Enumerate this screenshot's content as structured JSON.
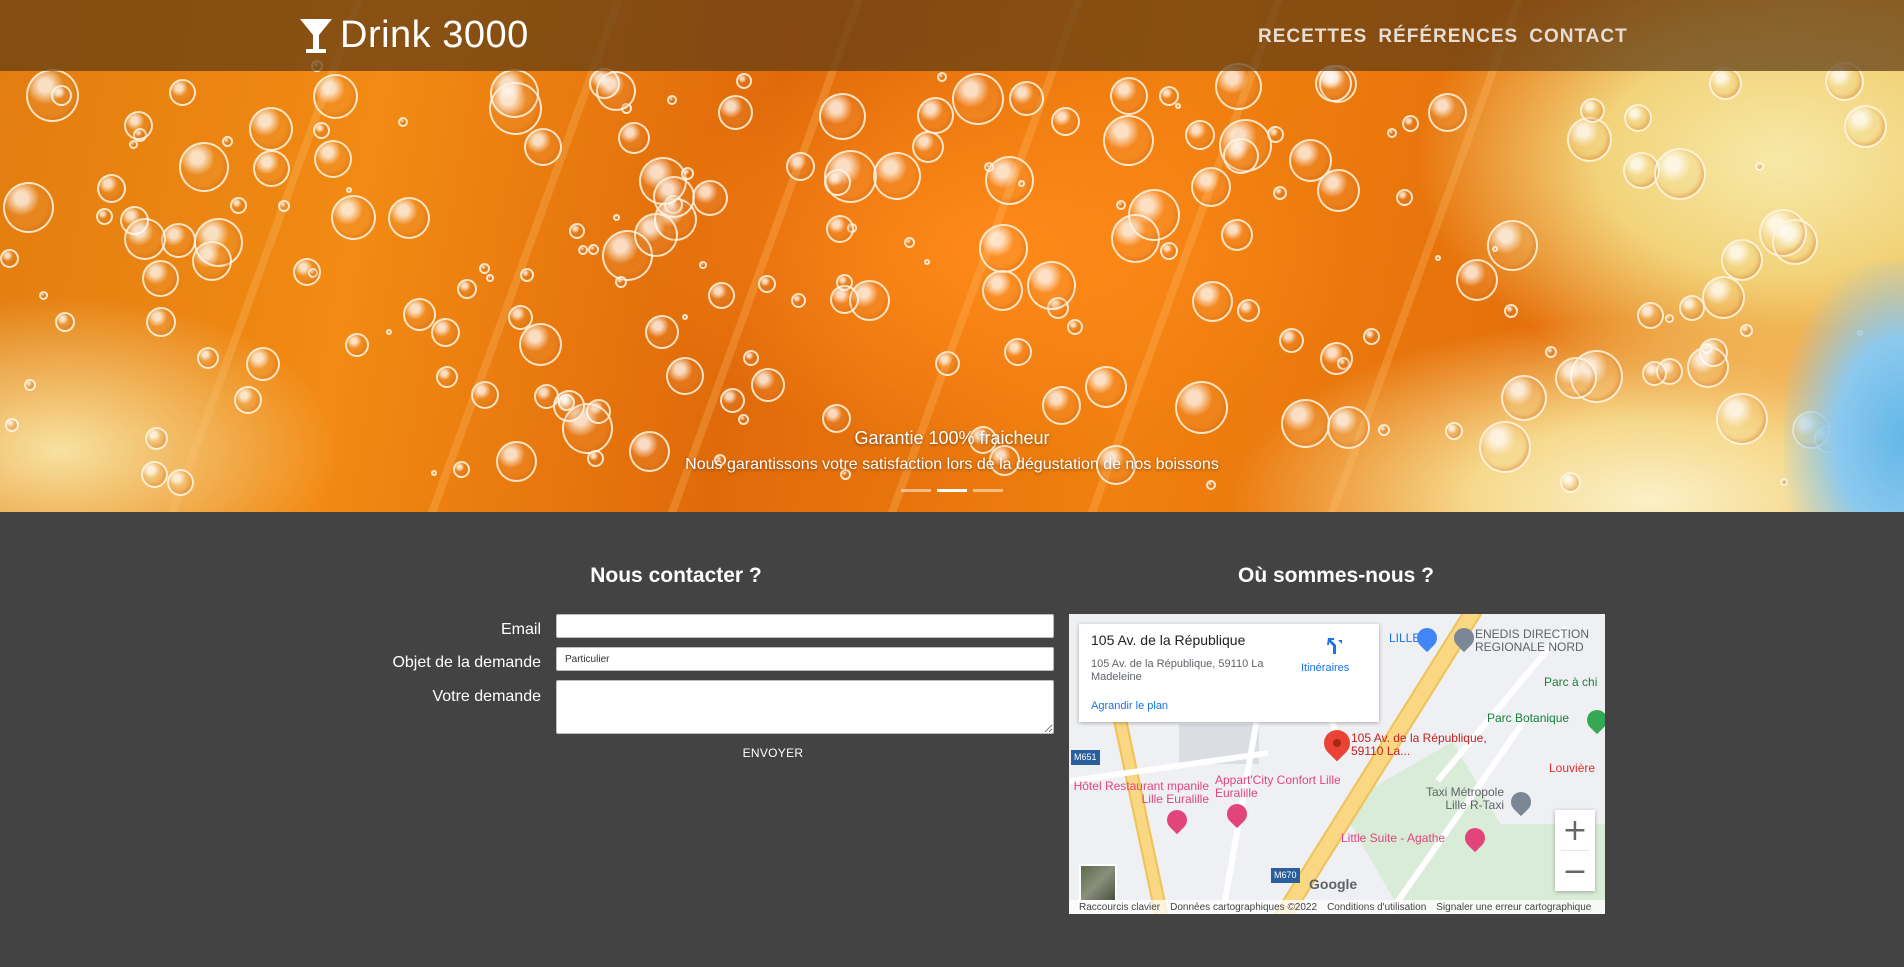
{
  "brand": {
    "name": "Drink 3000",
    "icon": "cocktail-glass-icon"
  },
  "nav": {
    "items": [
      "RECETTES",
      "RÉFÉRENCES",
      "CONTACT"
    ]
  },
  "carousel": {
    "caption_title": "Garantie 100% fraicheur",
    "caption_text": "Nous garantissons votre satisfaction lors de la dégustation de nos boissons",
    "slides": 3,
    "active_slide": 2
  },
  "contact": {
    "title": "Nous contacter ?",
    "email_label": "Email",
    "email_value": "",
    "subject_label": "Objet de la demande",
    "subject_value": "Particulier",
    "request_label": "Votre demande",
    "request_value": "",
    "send_label": "ENVOYER"
  },
  "location": {
    "title": "Où sommes-nous ?",
    "card": {
      "name": "105 Av. de la République",
      "address": "105 Av. de la République, 59110 La Madeleine",
      "directions": "Itinéraires",
      "enlarge": "Agrandir le plan"
    },
    "pin_label": "105 Av. de la République, 59110 La...",
    "places": {
      "enedis": "ENEDIS DIRECTION REGIONALE NORD",
      "parc_chi": "Parc à chi",
      "parc_botanique": "Parc Botanique",
      "louviere": "Louvière",
      "hotel": "Hôtel Restaurant mpanile Lille Euralille",
      "appart": "Appart'City Confort Lille Euralille",
      "taxi": "Taxi Métropole Lille R-Taxi",
      "little_suite": "Little Suite - Agathe",
      "lille_fragment": "LILLE",
      "m651": "M651",
      "m670": "M670",
      "google": "Google"
    },
    "attribution": [
      "Raccourcis clavier",
      "Données cartographiques ©2022",
      "Conditions d'utilisation",
      "Signaler une erreur cartographique"
    ],
    "zoom_in": "+",
    "zoom_out": "−"
  },
  "colors": {
    "page_bg": "#434343",
    "nav_text": "#e6ddd3",
    "pin": "#ea4335",
    "map_link": "#1a73e8",
    "poi_pink": "#e2457a",
    "poi_green": "#34a853"
  }
}
